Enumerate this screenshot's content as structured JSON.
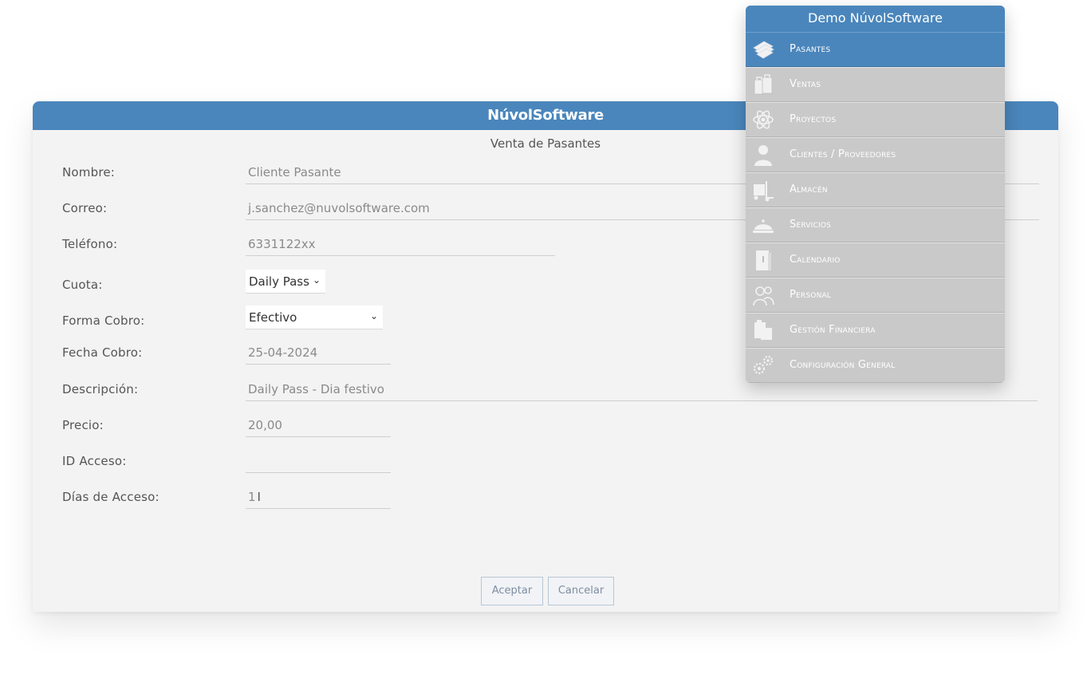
{
  "app_title": "NúvolSoftware",
  "form": {
    "heading": "Venta de Pasantes",
    "fields": {
      "nombre": {
        "label": "Nombre:",
        "value": "Cliente Pasante"
      },
      "correo": {
        "label": "Correo:",
        "value": "j.sanchez@nuvolsoftware.com"
      },
      "telefono": {
        "label": "Teléfono:",
        "value": "6331122xx"
      },
      "cuota": {
        "label": "Cuota:",
        "value": "Daily Pass"
      },
      "forma_cobro": {
        "label": "Forma Cobro:",
        "value": "Efectivo"
      },
      "fecha_cobro": {
        "label": "Fecha Cobro:",
        "value": "25-04-2024"
      },
      "descripcion": {
        "label": "Descripción:",
        "value": "Daily Pass - Dia festivo"
      },
      "precio": {
        "label": "Precio:",
        "value": "20,00"
      },
      "id_acceso": {
        "label": "ID Acceso:",
        "value": ""
      },
      "dias_acceso": {
        "label": "Días de Acceso:",
        "value": "1"
      }
    },
    "buttons": {
      "accept": "Aceptar",
      "cancel": "Cancelar"
    }
  },
  "menu": {
    "title": "Demo NúvolSoftware",
    "items": [
      {
        "label": "Pasantes",
        "icon": "tickets-icon",
        "active": true
      },
      {
        "label": "Ventas",
        "icon": "shopping-bags-icon",
        "active": false
      },
      {
        "label": "Proyectos",
        "icon": "atom-icon",
        "active": false
      },
      {
        "label": "Clientes / Proveedores",
        "icon": "person-icon",
        "active": false
      },
      {
        "label": "Almacén",
        "icon": "hand-truck-icon",
        "active": false
      },
      {
        "label": "Servicios",
        "icon": "service-bell-icon",
        "active": false
      },
      {
        "label": "Calendario",
        "icon": "calendar-icon",
        "active": false
      },
      {
        "label": "Personal",
        "icon": "staff-icon",
        "active": false
      },
      {
        "label": "Gestión Financiera",
        "icon": "finance-icon",
        "active": false
      },
      {
        "label": "Configuración General",
        "icon": "gears-icon",
        "active": false
      }
    ]
  }
}
